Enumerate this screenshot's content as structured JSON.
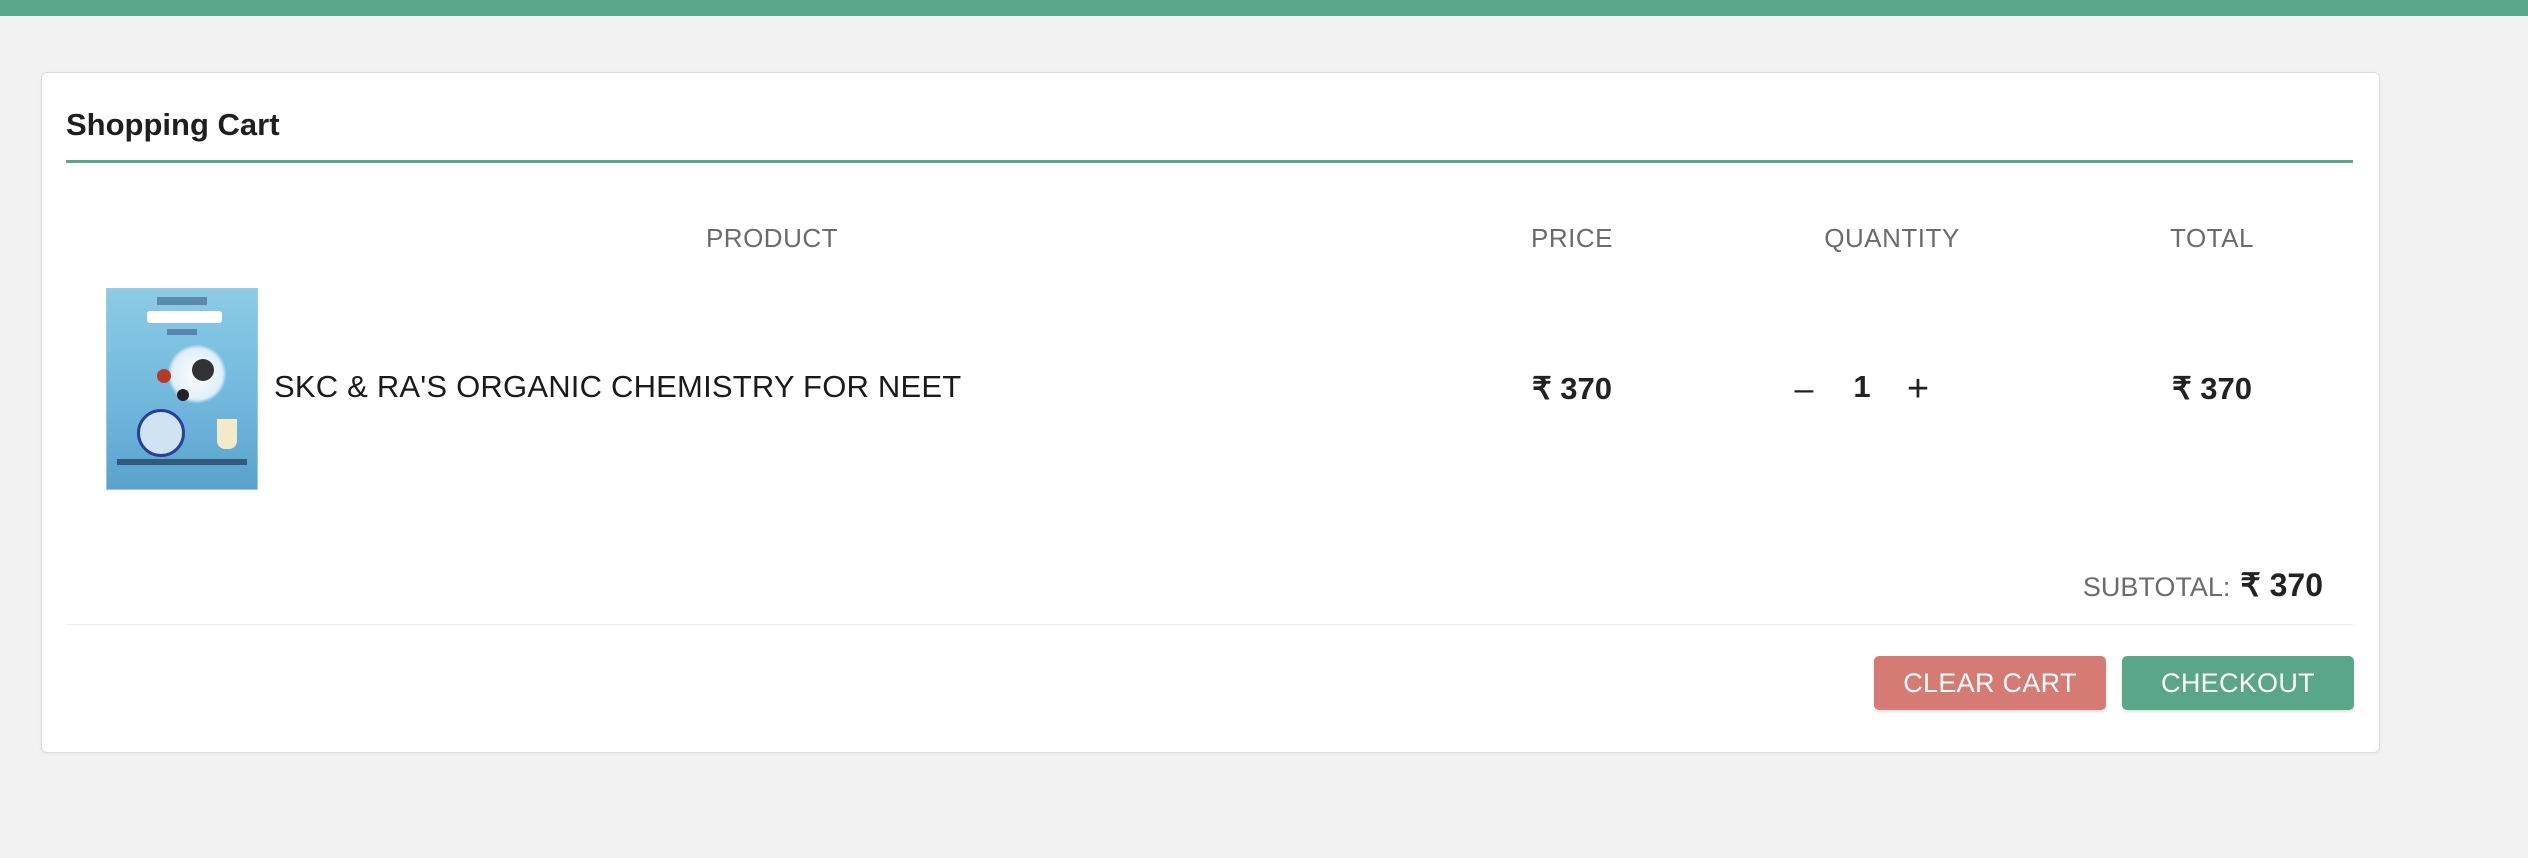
{
  "cart": {
    "title": "Shopping Cart",
    "headers": {
      "product": "PRODUCT",
      "price": "PRICE",
      "quantity": "QUANTITY",
      "total": "TOTAL"
    },
    "items": [
      {
        "name": "SKC & RA'S ORGANIC CHEMISTRY FOR NEET",
        "price": "₹ 370",
        "quantity": "1",
        "total": "₹ 370",
        "thumbnail": "book-cover-organic-chemistry"
      }
    ],
    "subtotal_label": "SUBTOTAL:",
    "subtotal_value": "₹ 370",
    "buttons": {
      "clear": "CLEAR CART",
      "checkout": "CHECKOUT"
    },
    "icons": {
      "decrease": "minus-icon",
      "increase": "plus-icon"
    },
    "colors": {
      "accent": "#5aa688",
      "danger": "#d67a74",
      "background": "#f2f2f2"
    }
  }
}
